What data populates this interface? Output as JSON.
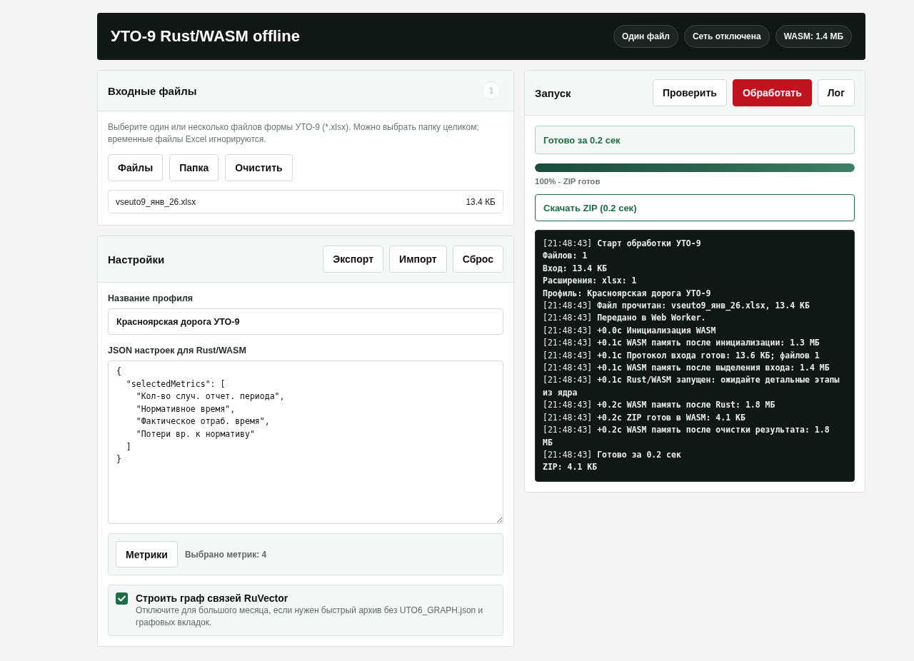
{
  "header": {
    "title": "УТО-9 Rust/WASM offline",
    "badges": [
      "Один файл",
      "Сеть отключена",
      "WASM: 1.4 МБ"
    ]
  },
  "input_files": {
    "title": "Входные файлы",
    "count_badge": "1",
    "hint": "Выберите один или несколько файлов формы УТО-9 (*.xlsx). Можно выбрать папку целиком; временные файлы Excel игнорируются.",
    "buttons": [
      "Файлы",
      "Папка",
      "Очистить"
    ],
    "files": [
      {
        "name": "vseuto9_янв_26.xlsx",
        "size": "13.4 КБ"
      }
    ]
  },
  "settings": {
    "title": "Настройки",
    "buttons": [
      "Экспорт",
      "Импорт",
      "Сброс"
    ],
    "profile_name": {
      "label": "Название профиля",
      "value": "Красноярская дорога УТО-9"
    },
    "json_settings": {
      "label": "JSON настроек для Rust/WASM",
      "value": "{\n  \"selectedMetrics\": [\n    \"Кол-во случ. отчет. периода\",\n    \"Нормативное время\",\n    \"Фактическое отраб. время\",\n    \"Потери вр. к нормативу\"\n  ]\n}"
    },
    "metrics": {
      "button": "Метрики",
      "summary": "Выбрано метрик: 4"
    },
    "graph_option": {
      "checked": true,
      "title": "Строить граф связей RuVector",
      "description": "Отключите для большого месяца, если нужен быстрый архив без UTO6_GRAPH.json и графовых вкладок."
    }
  },
  "run": {
    "title": "Запуск",
    "buttons": [
      {
        "label": "Проверить",
        "kind": "default"
      },
      {
        "label": "Обработать",
        "kind": "primary"
      },
      {
        "label": "Лог",
        "kind": "default"
      }
    ],
    "status": "Готово за 0.2 сек",
    "progress": {
      "level": 1,
      "caption": "100% - ZIP готов"
    },
    "download_button": "Скачать ZIP (0.2 сек)",
    "log": [
      {
        "time": "[21:48:43]",
        "text": "Старт обработки УТО-9"
      },
      {
        "text": "Файлов: 1"
      },
      {
        "text": "Вход: 13.4 КБ"
      },
      {
        "text": "Расширения: xlsx: 1"
      },
      {
        "text": "Профиль: Красноярская дорога УТО-9"
      },
      {
        "time": "[21:48:43]",
        "text": "Файл прочитан: vseuto9_янв_26.xlsx, 13.4 КБ"
      },
      {
        "time": "[21:48:43]",
        "text": "Передано в Web Worker."
      },
      {
        "time": "[21:48:43]",
        "text": "+0.0с Инициализация WASM"
      },
      {
        "time": "[21:48:43]",
        "text": "+0.1с WASM память после инициализации: 1.3 МБ"
      },
      {
        "time": "[21:48:43]",
        "text": "+0.1с Протокол входа готов: 13.6 КБ; файлов 1"
      },
      {
        "time": "[21:48:43]",
        "text": "+0.1с WASM память после выделения входа: 1.4 МБ"
      },
      {
        "time": "[21:48:43]",
        "text": "+0.1с Rust/WASM запущен: ожидайте детальные этапы из ядра"
      },
      {
        "time": "[21:48:43]",
        "text": "+0.2с WASM память после Rust: 1.8 МБ"
      },
      {
        "time": "[21:48:43]",
        "text": "+0.2с ZIP готов в WASM: 4.1 КБ"
      },
      {
        "time": "[21:48:43]",
        "text": "+0.2с WASM память после очистки результата: 1.8 МБ"
      },
      {
        "time": "[21:48:43]",
        "text": "Готово за 0.2 сек"
      },
      {
        "text": "ZIP: 4.1 КБ"
      }
    ]
  }
}
